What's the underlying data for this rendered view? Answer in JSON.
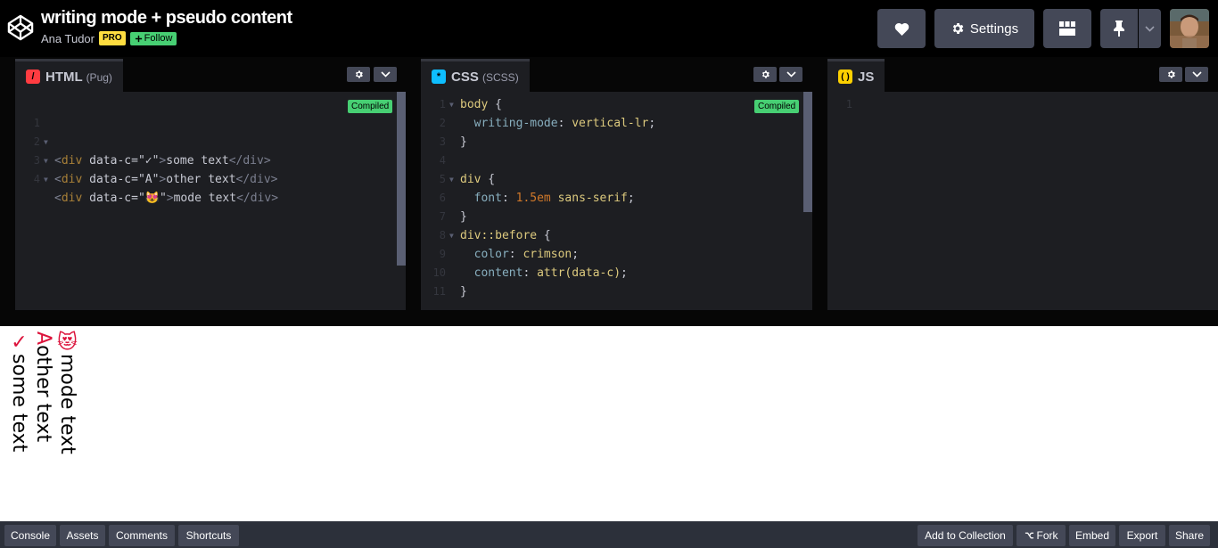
{
  "header": {
    "title": "writing mode + pseudo content",
    "author": "Ana Tudor",
    "pro_badge": "PRO",
    "follow_label": "Follow",
    "settings_label": "Settings"
  },
  "editors": {
    "html": {
      "name": "HTML",
      "preprocessor": "(Pug)",
      "compiled_label": "Compiled",
      "lines": [
        {
          "num": "1"
        },
        {
          "num": "2",
          "open": "<",
          "tag": "div",
          "attr": " data-c",
          "eq": "=",
          "val": "\"✓\"",
          "close": ">",
          "text": "some text",
          "end": "</div>"
        },
        {
          "num": "3",
          "open": "<",
          "tag": "div",
          "attr": " data-c",
          "eq": "=",
          "val": "\"A\"",
          "close": ">",
          "text": "other text",
          "end": "</div>"
        },
        {
          "num": "4",
          "open": "<",
          "tag": "div",
          "attr": " data-c",
          "eq": "=",
          "val": "\"😻\"",
          "close": ">",
          "text": "mode text",
          "end": "</div>"
        }
      ]
    },
    "css": {
      "name": "CSS",
      "preprocessor": "(SCSS)",
      "compiled_label": "Compiled",
      "lines": [
        {
          "num": "1",
          "sel": "body",
          "rest": " {"
        },
        {
          "num": "2",
          "prop": "  writing-mode",
          "colon": ": ",
          "val": "vertical-lr",
          "end": ";"
        },
        {
          "num": "3",
          "rest": "}"
        },
        {
          "num": "4"
        },
        {
          "num": "5",
          "sel": "div",
          "rest": " {"
        },
        {
          "num": "6",
          "prop": "  font",
          "colon": ": ",
          "num_val": "1.5em",
          "val": " sans-serif",
          "end": ";"
        },
        {
          "num": "7",
          "rest": "}"
        },
        {
          "num": "8",
          "sel": "div::before",
          "rest": " {"
        },
        {
          "num": "9",
          "prop": "  color",
          "colon": ": ",
          "val": "crimson",
          "end": ";"
        },
        {
          "num": "10",
          "prop": "  content",
          "colon": ": ",
          "val": "attr(data-c)",
          "end": ";"
        },
        {
          "num": "11",
          "rest": "}"
        }
      ]
    },
    "js": {
      "name": "JS",
      "lines": [
        {
          "num": "1"
        }
      ]
    }
  },
  "preview": {
    "items": [
      {
        "before": "✓",
        "text": "some text"
      },
      {
        "before": "A",
        "text": "other text"
      },
      {
        "before": "😻",
        "text": "mode text"
      }
    ]
  },
  "footer": {
    "left": [
      "Console",
      "Assets",
      "Comments",
      "Shortcuts"
    ],
    "right": [
      "Add to Collection",
      "Fork",
      "Embed",
      "Export",
      "Share"
    ]
  },
  "colors": {
    "accent_green": "#47cf73",
    "pro_yellow": "#ffdd40",
    "html_icon": "#ff3c41",
    "css_icon": "#0ebeff",
    "js_icon": "#fcd000",
    "pseudo_color": "crimson"
  },
  "icons": [
    "codepen-logo-icon",
    "heart-icon",
    "gear-icon",
    "layout-icon",
    "pin-icon",
    "chevron-down-icon",
    "fork-icon"
  ]
}
